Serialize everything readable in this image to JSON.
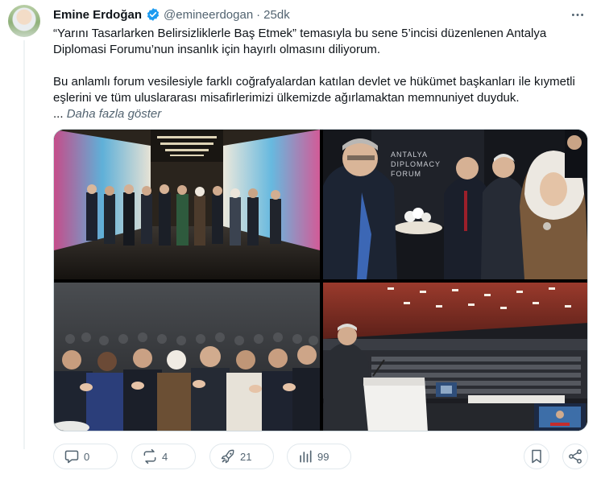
{
  "author": {
    "display_name": "Emine Erdoğan",
    "handle": "@emineerdogan",
    "time": "25dk",
    "verified": true
  },
  "post": {
    "paragraphs": [
      "“Yarını Tasarlarken Belirsizliklerle Baş Etmek” temasıyla bu sene 5’incisi düzenlenen Antalya Diplomasi Forumu’nun insanlık için hayırlı olmasını diliyorum.",
      "Bu anlamlı forum vesilesiyle farklı coğrafyalardan katılan devlet ve hükümet başkanları ile kıymetli eşlerini ve tüm uluslararası misafirlerimizi ülkemizde ağırlamaktan memnuniyet duyduk."
    ],
    "ellipsis": "...",
    "show_more": "Daha fazla göster"
  },
  "media": {
    "photo_texts": {
      "backdrop_line1": "ANTALYA",
      "backdrop_line2": "DIPLOMACY",
      "backdrop_line3": "FORUM"
    }
  },
  "actions": {
    "replies": "0",
    "reposts": "4",
    "likes": "21",
    "views": "99"
  },
  "icons": {
    "verified": "verified-badge-icon",
    "more": "more-dots-icon",
    "reply": "reply-bubble-icon",
    "repost": "repost-arrows-icon",
    "like": "rocket-icon",
    "views": "bar-chart-icon",
    "bookmark": "bookmark-icon",
    "share": "share-icon"
  },
  "colors": {
    "verified_blue": "#1d9bf0",
    "muted": "#536471",
    "text": "#0f1419",
    "border": "#cfd9de"
  }
}
